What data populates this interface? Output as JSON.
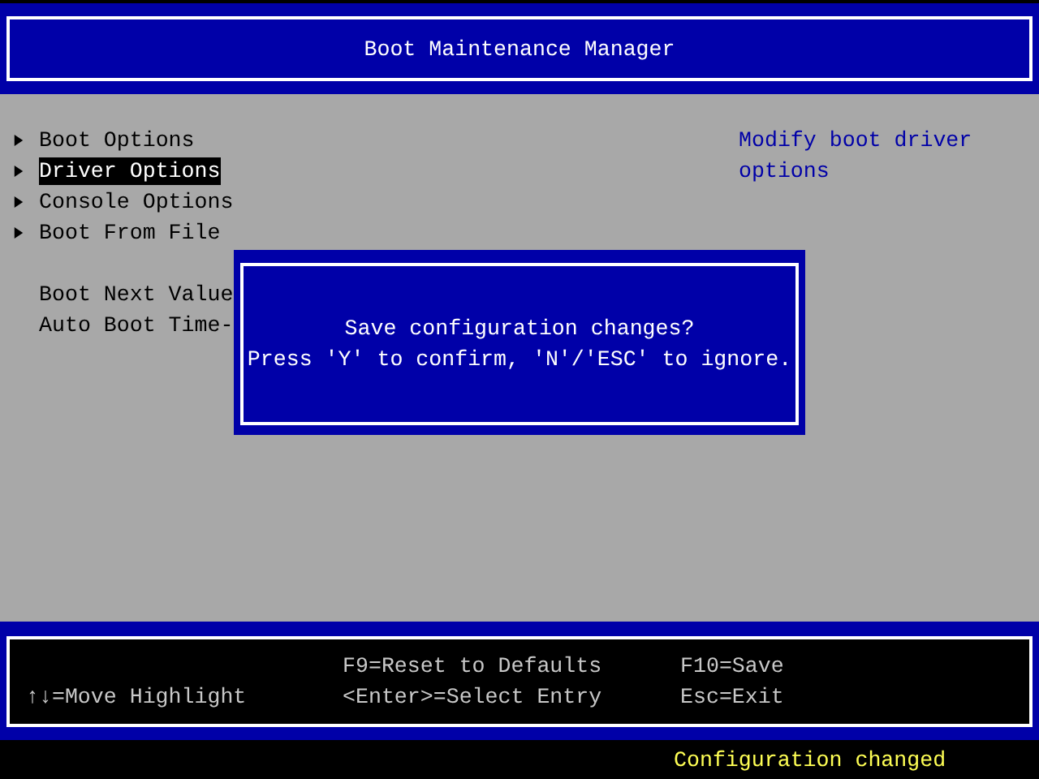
{
  "window": {
    "title": "Boot Maintenance Manager"
  },
  "menu": [
    {
      "kind": "submenu",
      "label": "Boot Options",
      "selected": false
    },
    {
      "kind": "submenu",
      "label": "Driver Options",
      "selected": true
    },
    {
      "kind": "submenu",
      "label": "Console Options",
      "selected": false
    },
    {
      "kind": "submenu",
      "label": "Boot From File",
      "selected": false
    },
    {
      "kind": "spacer"
    },
    {
      "kind": "value",
      "label": "Boot Next Value",
      "selected": false
    },
    {
      "kind": "value",
      "label": "Auto Boot Time-",
      "selected": false
    }
  ],
  "help_text": [
    "Modify boot driver",
    "options"
  ],
  "dialog": {
    "lines": [
      "Save configuration changes?",
      "Press 'Y' to confirm, 'N'/'ESC' to ignore."
    ]
  },
  "key_help": [
    {
      "lines": [
        "↑↓=Move Highlight"
      ]
    },
    {
      "lines": [
        "F9=Reset to Defaults",
        "<Enter>=Select Entry"
      ]
    },
    {
      "lines": [
        "F10=Save",
        "Esc=Exit"
      ]
    }
  ],
  "status_bar": "Configuration changed"
}
